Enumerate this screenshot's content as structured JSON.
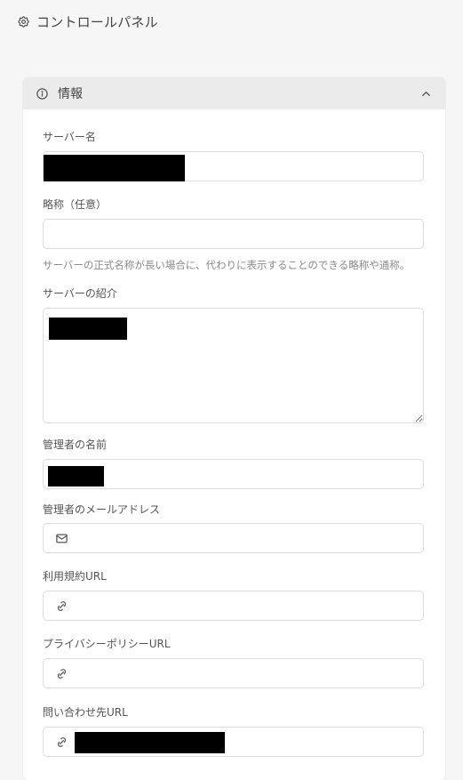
{
  "header": {
    "title": "コントロールパネル",
    "icon": "gear-icon"
  },
  "panel": {
    "title": "情報",
    "icon": "info-icon",
    "collapse_icon": "chevron-up-icon",
    "header_background": "#ebebeb"
  },
  "fields": {
    "server_name": {
      "label": "サーバー名",
      "value": ""
    },
    "short_name": {
      "label": "略称（任意）",
      "value": "",
      "hint": "サーバーの正式名称が長い場合に、代わりに表示することのできる略称や通称。"
    },
    "description": {
      "label": "サーバーの紹介",
      "value": ""
    },
    "maintainer_name": {
      "label": "管理者の名前",
      "value": ""
    },
    "maintainer_email": {
      "label": "管理者のメールアドレス",
      "value": "",
      "icon": "mail-icon"
    },
    "tos_url": {
      "label": "利用規約URL",
      "value": "",
      "icon": "link-icon"
    },
    "privacy_url": {
      "label": "プライバシーポリシーURL",
      "value": "",
      "icon": "link-icon"
    },
    "inquiry_url": {
      "label": "問い合わせ先URL",
      "value": "",
      "icon": "link-icon"
    }
  }
}
